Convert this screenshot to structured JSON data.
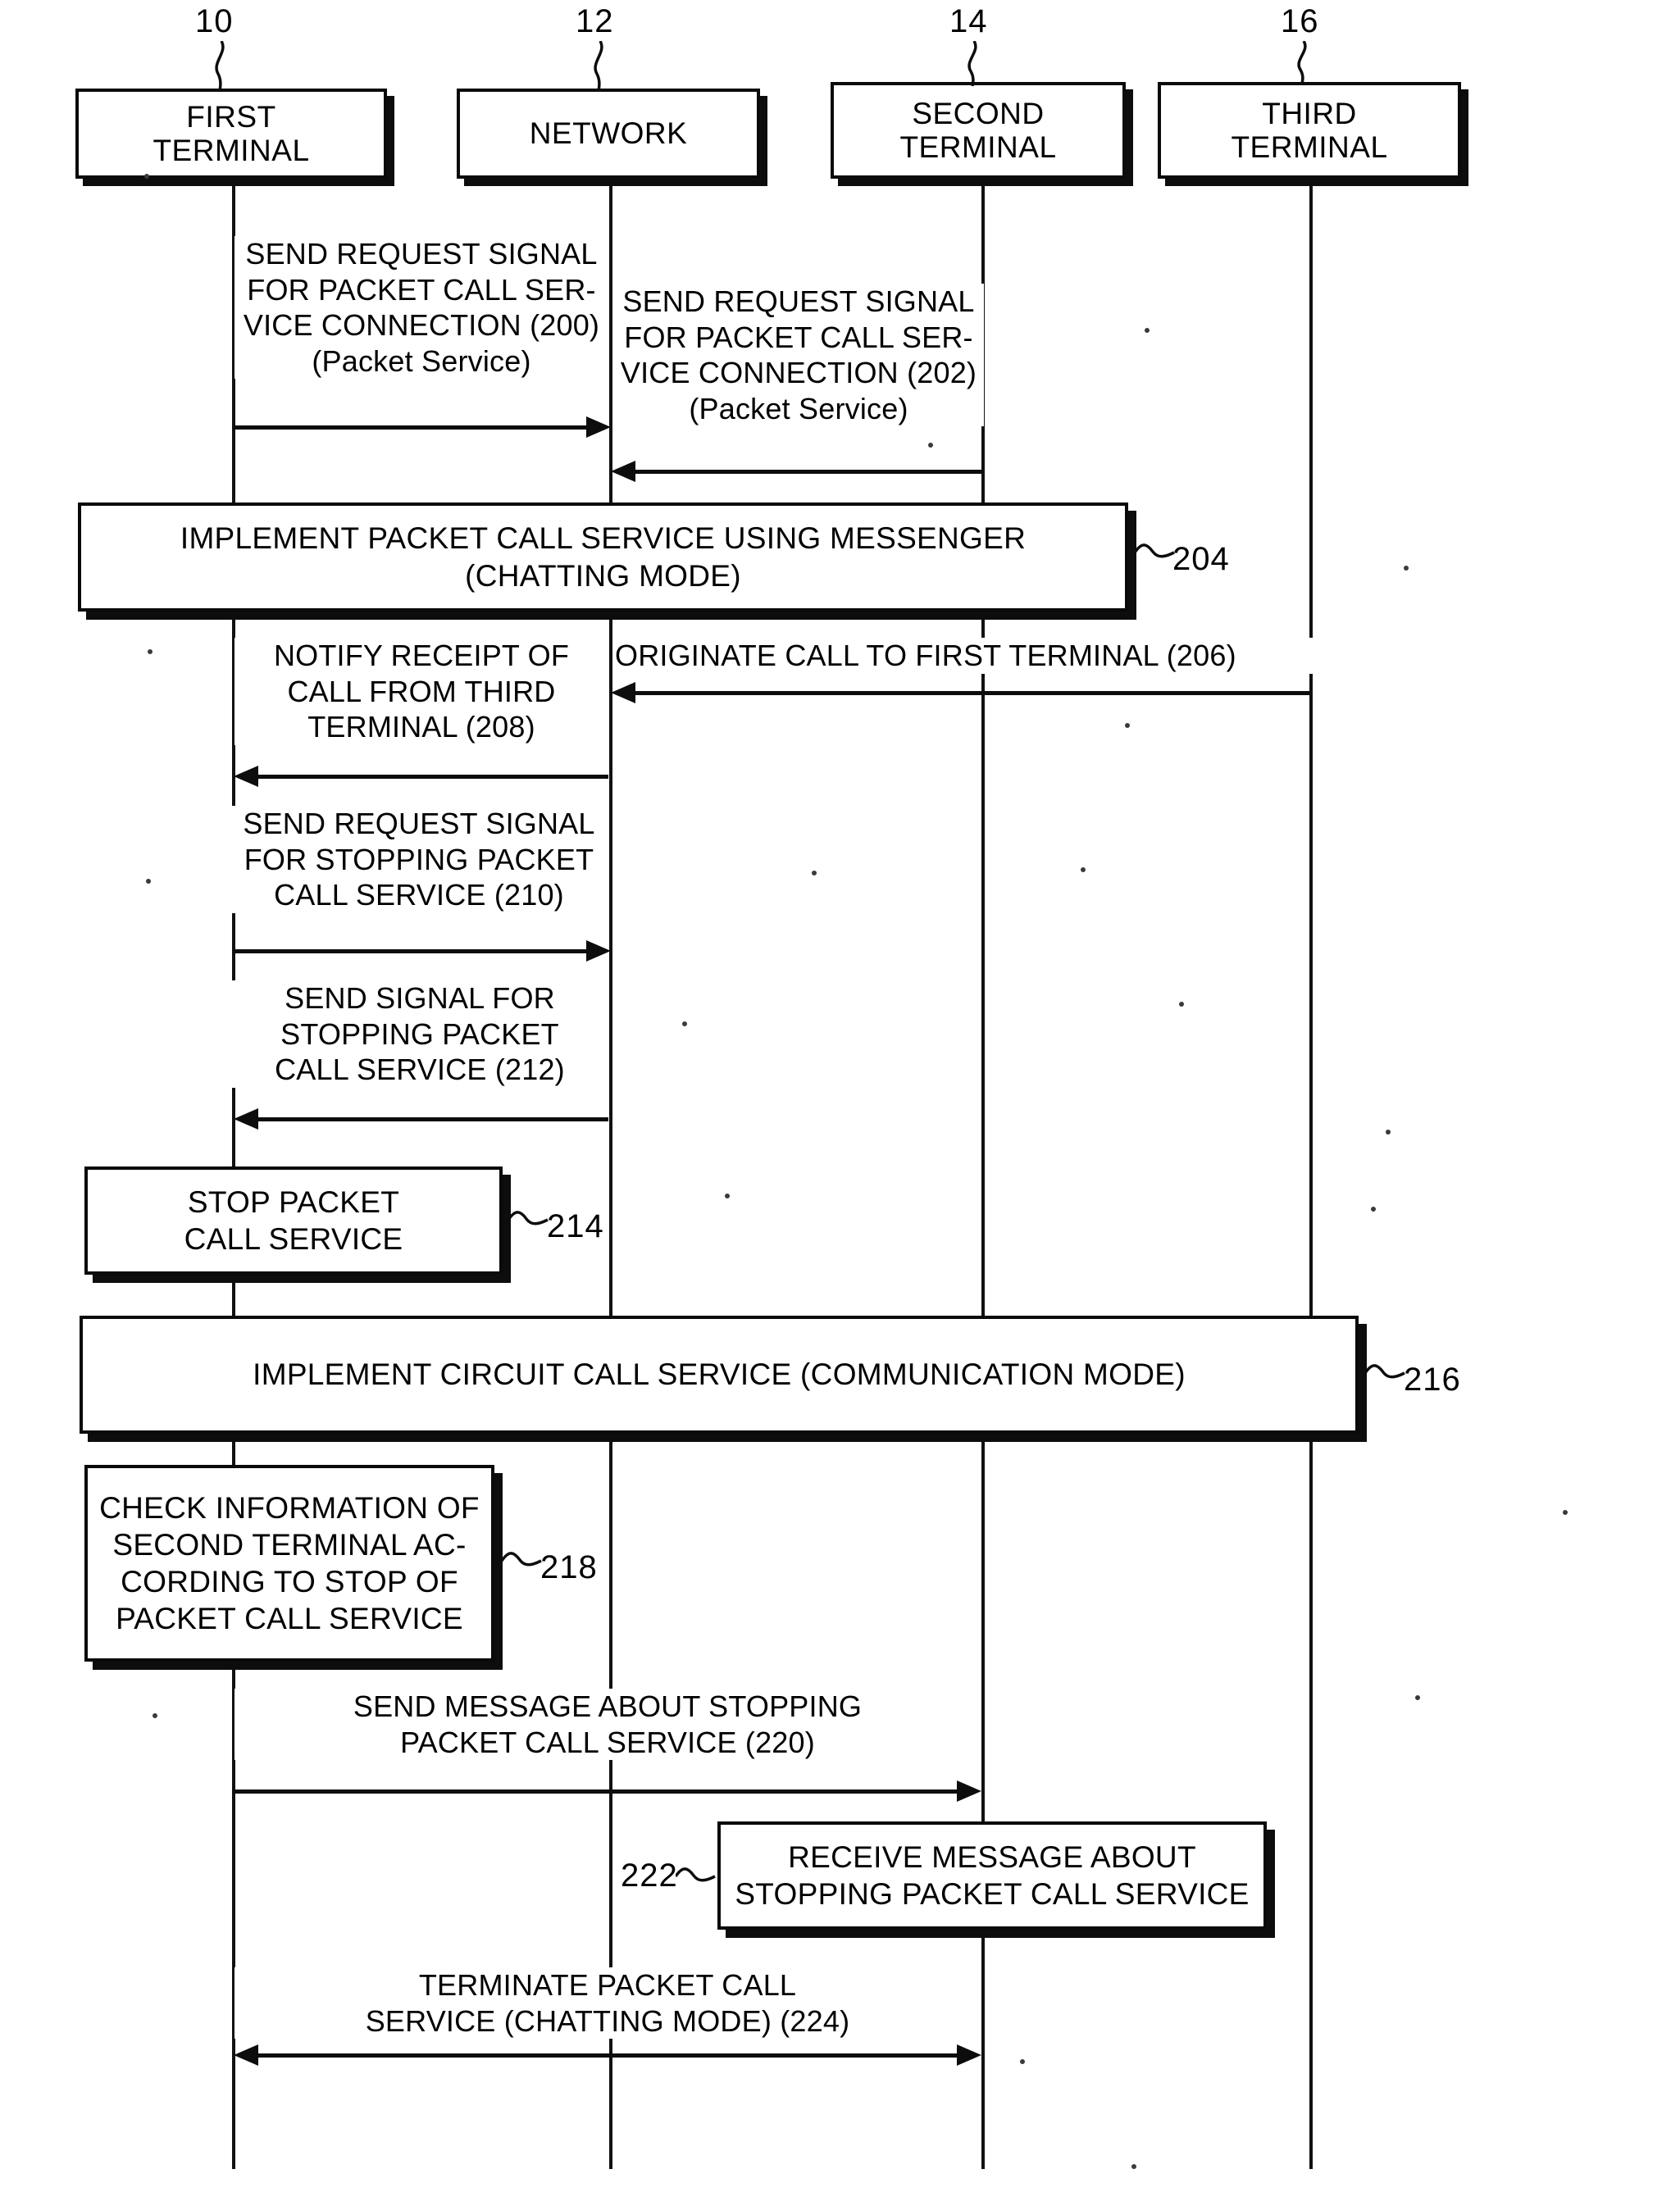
{
  "figure": {
    "kind": "patent-sequence-diagram",
    "actors": [
      {
        "ref": "10",
        "label": "FIRST\nTERMINAL"
      },
      {
        "ref": "12",
        "label": "NETWORK"
      },
      {
        "ref": "14",
        "label": "SECOND\nTERMINAL"
      },
      {
        "ref": "16",
        "label": "THIRD\nTERMINAL"
      }
    ],
    "messages": [
      {
        "id": "200",
        "text": "SEND REQUEST SIGNAL\nFOR PACKET CALL SER-\nVICE CONNECTION (200)\n(Packet Service)",
        "from": "FIRST TERMINAL",
        "to": "NETWORK",
        "direction": "right"
      },
      {
        "id": "202",
        "text": "SEND REQUEST SIGNAL\nFOR PACKET CALL SER-\nVICE CONNECTION (202)\n(Packet Service)",
        "from": "SECOND TERMINAL",
        "to": "NETWORK",
        "direction": "left"
      },
      {
        "id": "206",
        "text": "ORIGINATE CALL TO FIRST TERMINAL (206)",
        "from": "THIRD TERMINAL",
        "to": "NETWORK",
        "direction": "left"
      },
      {
        "id": "208",
        "text": "NOTIFY RECEIPT OF\nCALL FROM THIRD\nTERMINAL (208)",
        "from": "NETWORK",
        "to": "FIRST TERMINAL",
        "direction": "left"
      },
      {
        "id": "210",
        "text": "SEND REQUEST SIGNAL\nFOR STOPPING PACKET\nCALL SERVICE (210)",
        "from": "FIRST TERMINAL",
        "to": "NETWORK",
        "direction": "right"
      },
      {
        "id": "212",
        "text": "SEND SIGNAL FOR\nSTOPPING PACKET\nCALL SERVICE (212)",
        "from": "NETWORK",
        "to": "FIRST TERMINAL",
        "direction": "left"
      },
      {
        "id": "220",
        "text": "SEND MESSAGE ABOUT STOPPING\nPACKET CALL SERVICE (220)",
        "from": "FIRST TERMINAL",
        "to": "SECOND TERMINAL",
        "direction": "right"
      },
      {
        "id": "224",
        "text": "TERMINATE PACKET CALL\nSERVICE (CHATTING MODE) (224)",
        "from": "FIRST TERMINAL",
        "to": "SECOND TERMINAL",
        "direction": "both"
      }
    ],
    "process_boxes": [
      {
        "id": "204",
        "text": "IMPLEMENT PACKET CALL SERVICE USING MESSENGER\n(CHATTING MODE)",
        "ref": "204"
      },
      {
        "id": "214",
        "text": "STOP PACKET\nCALL SERVICE",
        "ref": "214"
      },
      {
        "id": "216",
        "text": "IMPLEMENT CIRCUIT CALL SERVICE (COMMUNICATION MODE)",
        "ref": "216"
      },
      {
        "id": "218",
        "text": "CHECK INFORMATION OF\nSECOND TERMINAL AC-\nCORDING TO STOP OF\nPACKET CALL SERVICE",
        "ref": "218"
      },
      {
        "id": "222",
        "text": "RECEIVE MESSAGE ABOUT\nSTOPPING PACKET CALL SERVICE",
        "ref": "222"
      }
    ],
    "colors": {
      "ink": "#0d0d0d",
      "paper": "#ffffff"
    }
  }
}
